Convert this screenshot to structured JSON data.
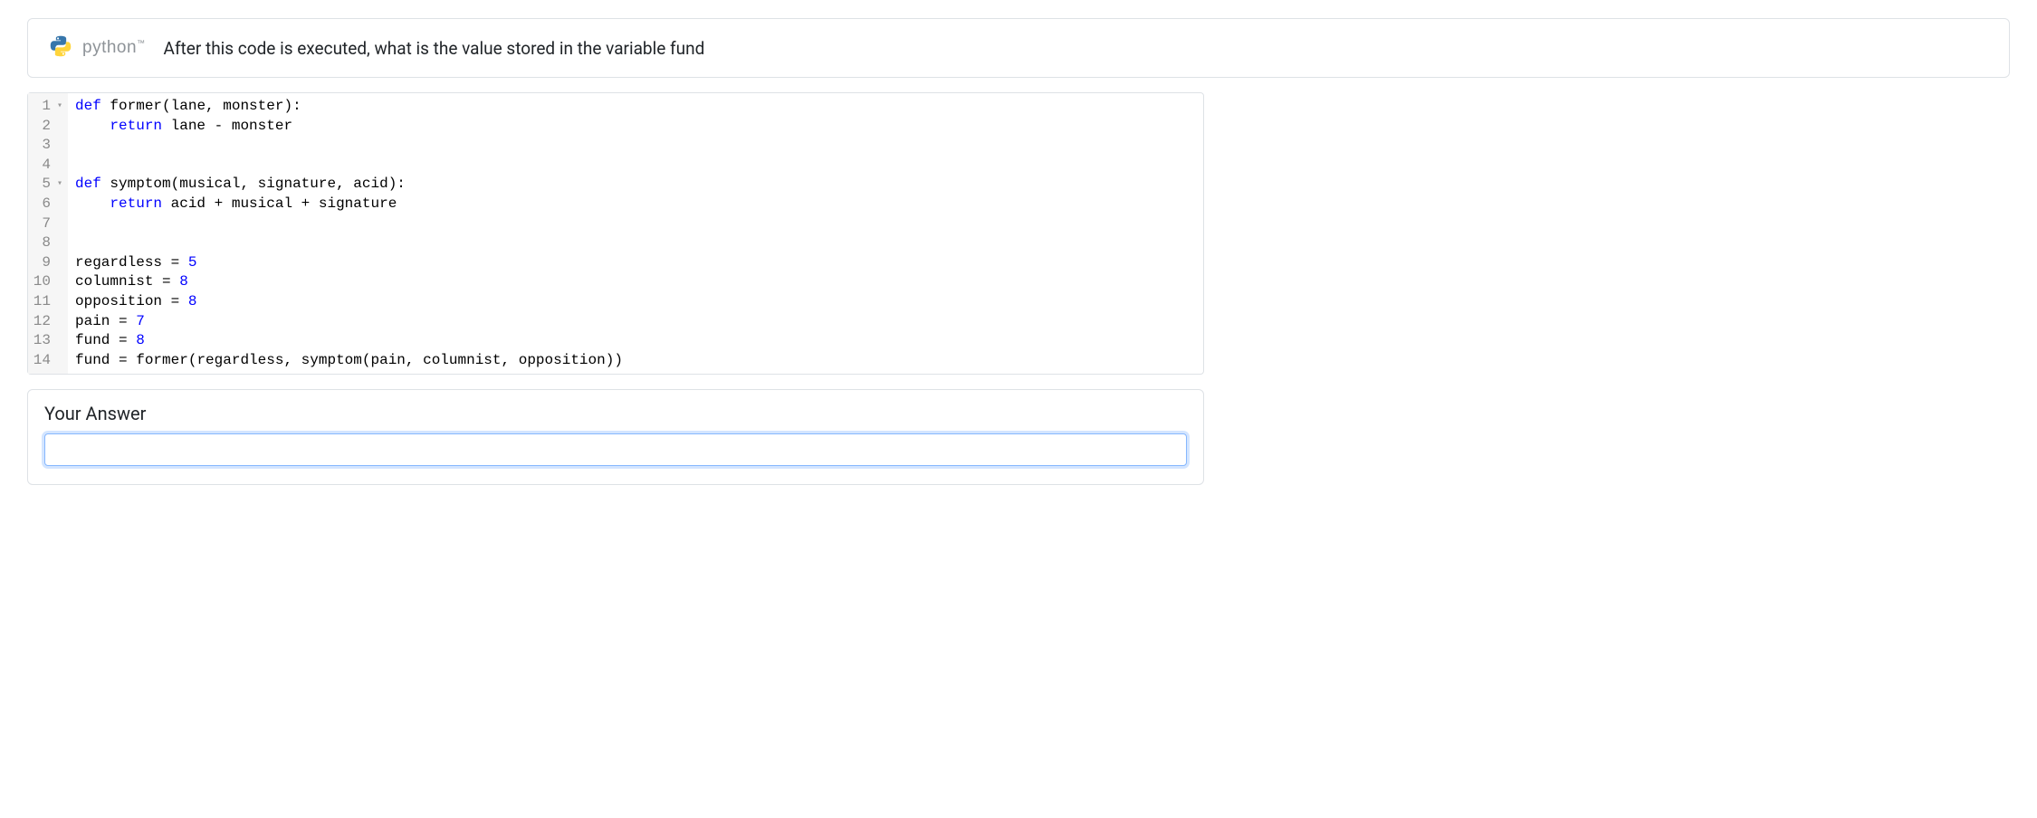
{
  "header": {
    "language_label": "python",
    "trademark": "™",
    "question": "After this code is executed, what is the value stored in the variable fund"
  },
  "code": {
    "lines": [
      {
        "n": "1",
        "foldable": true,
        "tokens": [
          {
            "t": "def",
            "c": "tk-keyword"
          },
          {
            "t": " ",
            "c": ""
          },
          {
            "t": "former",
            "c": "tk-funcname"
          },
          {
            "t": "(",
            "c": "tk-paren"
          },
          {
            "t": "lane",
            "c": "tk-ident"
          },
          {
            "t": ", ",
            "c": "tk-comma"
          },
          {
            "t": "monster",
            "c": "tk-ident"
          },
          {
            "t": "):",
            "c": "tk-paren"
          }
        ]
      },
      {
        "n": "2",
        "foldable": false,
        "tokens": [
          {
            "t": "    ",
            "c": ""
          },
          {
            "t": "return",
            "c": "tk-keyword"
          },
          {
            "t": " ",
            "c": ""
          },
          {
            "t": "lane",
            "c": "tk-ident"
          },
          {
            "t": " - ",
            "c": "tk-operator"
          },
          {
            "t": "monster",
            "c": "tk-ident"
          }
        ]
      },
      {
        "n": "3",
        "foldable": false,
        "tokens": []
      },
      {
        "n": "4",
        "foldable": false,
        "tokens": []
      },
      {
        "n": "5",
        "foldable": true,
        "tokens": [
          {
            "t": "def",
            "c": "tk-keyword"
          },
          {
            "t": " ",
            "c": ""
          },
          {
            "t": "symptom",
            "c": "tk-funcname"
          },
          {
            "t": "(",
            "c": "tk-paren"
          },
          {
            "t": "musical",
            "c": "tk-ident"
          },
          {
            "t": ", ",
            "c": "tk-comma"
          },
          {
            "t": "signature",
            "c": "tk-ident"
          },
          {
            "t": ", ",
            "c": "tk-comma"
          },
          {
            "t": "acid",
            "c": "tk-ident"
          },
          {
            "t": "):",
            "c": "tk-paren"
          }
        ]
      },
      {
        "n": "6",
        "foldable": false,
        "tokens": [
          {
            "t": "    ",
            "c": ""
          },
          {
            "t": "return",
            "c": "tk-keyword"
          },
          {
            "t": " ",
            "c": ""
          },
          {
            "t": "acid",
            "c": "tk-ident"
          },
          {
            "t": " + ",
            "c": "tk-operator"
          },
          {
            "t": "musical",
            "c": "tk-ident"
          },
          {
            "t": " + ",
            "c": "tk-operator"
          },
          {
            "t": "signature",
            "c": "tk-ident"
          }
        ]
      },
      {
        "n": "7",
        "foldable": false,
        "tokens": []
      },
      {
        "n": "8",
        "foldable": false,
        "tokens": []
      },
      {
        "n": "9",
        "foldable": false,
        "tokens": [
          {
            "t": "regardless",
            "c": "tk-ident"
          },
          {
            "t": " = ",
            "c": "tk-operator"
          },
          {
            "t": "5",
            "c": "tk-number"
          }
        ]
      },
      {
        "n": "10",
        "foldable": false,
        "tokens": [
          {
            "t": "columnist",
            "c": "tk-ident"
          },
          {
            "t": " = ",
            "c": "tk-operator"
          },
          {
            "t": "8",
            "c": "tk-number"
          }
        ]
      },
      {
        "n": "11",
        "foldable": false,
        "tokens": [
          {
            "t": "opposition",
            "c": "tk-ident"
          },
          {
            "t": " = ",
            "c": "tk-operator"
          },
          {
            "t": "8",
            "c": "tk-number"
          }
        ]
      },
      {
        "n": "12",
        "foldable": false,
        "tokens": [
          {
            "t": "pain",
            "c": "tk-ident"
          },
          {
            "t": " = ",
            "c": "tk-operator"
          },
          {
            "t": "7",
            "c": "tk-number"
          }
        ]
      },
      {
        "n": "13",
        "foldable": false,
        "tokens": [
          {
            "t": "fund",
            "c": "tk-ident"
          },
          {
            "t": " = ",
            "c": "tk-operator"
          },
          {
            "t": "8",
            "c": "tk-number"
          }
        ]
      },
      {
        "n": "14",
        "foldable": false,
        "tokens": [
          {
            "t": "fund",
            "c": "tk-ident"
          },
          {
            "t": " = ",
            "c": "tk-operator"
          },
          {
            "t": "former",
            "c": "tk-ident"
          },
          {
            "t": "(",
            "c": "tk-paren"
          },
          {
            "t": "regardless",
            "c": "tk-ident"
          },
          {
            "t": ", ",
            "c": "tk-comma"
          },
          {
            "t": "symptom",
            "c": "tk-ident"
          },
          {
            "t": "(",
            "c": "tk-paren"
          },
          {
            "t": "pain",
            "c": "tk-ident"
          },
          {
            "t": ", ",
            "c": "tk-comma"
          },
          {
            "t": "columnist",
            "c": "tk-ident"
          },
          {
            "t": ", ",
            "c": "tk-comma"
          },
          {
            "t": "opposition",
            "c": "tk-ident"
          },
          {
            "t": "))",
            "c": "tk-paren"
          }
        ]
      }
    ]
  },
  "answer": {
    "label": "Your Answer",
    "value": "",
    "placeholder": ""
  }
}
